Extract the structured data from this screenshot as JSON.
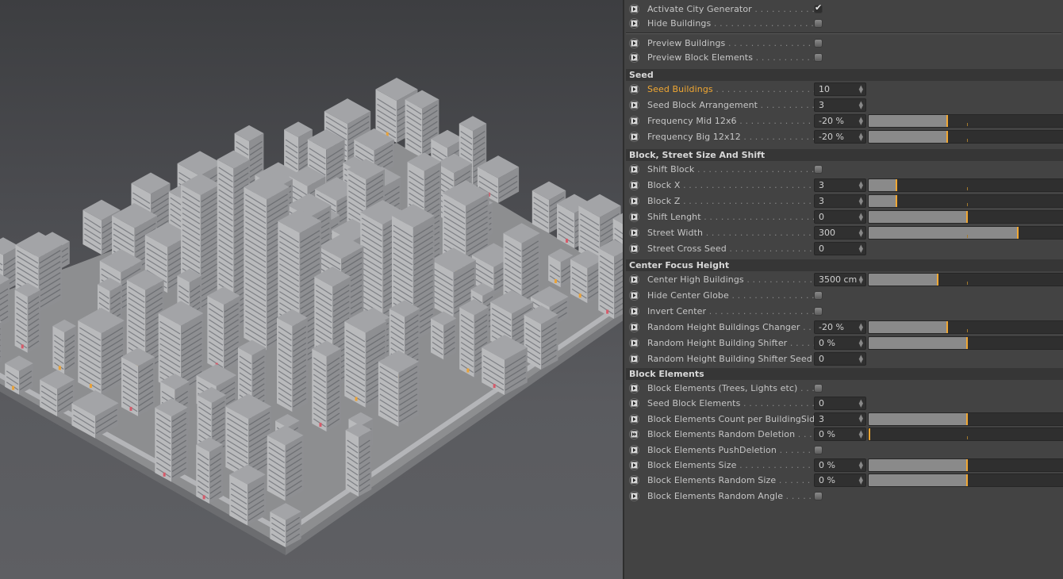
{
  "viewport": {
    "scene": "isometric-city-render",
    "background_color": "#4b4c50"
  },
  "panel": {
    "accent_color": "#f0a733",
    "top_rows": [
      {
        "label": "Activate City Generator",
        "type": "checkbox",
        "checked": true
      },
      {
        "label": "Hide Buildings",
        "type": "checkbox",
        "checked": false
      }
    ],
    "preview_rows": [
      {
        "label": "Preview Buildings",
        "type": "checkbox",
        "checked": false
      },
      {
        "label": "Preview Block Elements",
        "type": "checkbox",
        "checked": false
      }
    ],
    "groups": [
      {
        "title": "Seed",
        "rows": [
          {
            "label": "Seed Buildings",
            "type": "number",
            "value": "10",
            "active": true
          },
          {
            "label": "Seed Block Arrangement",
            "type": "number",
            "value": "3"
          },
          {
            "label": "Frequency Mid 12x6",
            "type": "slider",
            "value": "-20 %",
            "fraction": 0.4
          },
          {
            "label": "Frequency Big 12x12",
            "type": "slider",
            "value": "-20 %",
            "fraction": 0.4
          }
        ]
      },
      {
        "title": "Block, Street Size And Shift",
        "rows": [
          {
            "label": "Shift Block",
            "type": "checkbox",
            "checked": false
          },
          {
            "label": "Block X",
            "type": "slider",
            "value": "3",
            "fraction": 0.14
          },
          {
            "label": "Block Z",
            "type": "slider",
            "value": "3",
            "fraction": 0.14
          },
          {
            "label": "Shift Lenght",
            "type": "slider",
            "value": "0",
            "fraction": 0.5
          },
          {
            "label": "Street Width",
            "type": "slider",
            "value": "300",
            "fraction": 0.76
          },
          {
            "label": "Street Cross Seed",
            "type": "number",
            "value": "0"
          }
        ]
      },
      {
        "title": "Center Focus Height",
        "rows": [
          {
            "label": "Center High Buildings",
            "type": "slider",
            "value": "3500 cm",
            "fraction": 0.35
          },
          {
            "label": "Hide Center Globe",
            "type": "checkbox",
            "checked": false
          },
          {
            "label": "Invert Center",
            "type": "checkbox",
            "checked": false
          },
          {
            "label": "Random Height Buildings Changer",
            "type": "slider",
            "value": "-20 %",
            "fraction": 0.4
          },
          {
            "label": "Random Height Building Shifter",
            "type": "slider",
            "value": "0 %",
            "fraction": 0.5
          },
          {
            "label": "Random Height Building Shifter Seed",
            "type": "number",
            "value": "0"
          }
        ]
      },
      {
        "title": "Block Elements",
        "rows": [
          {
            "label": "Block Elements (Trees, Lights etc)",
            "type": "checkbox",
            "checked": false
          },
          {
            "label": "Seed Block Elements",
            "type": "number",
            "value": "0"
          },
          {
            "label": "Block Elements Count per BuildingSide",
            "type": "slider",
            "value": "3",
            "fraction": 0.5
          },
          {
            "label": "Block Elements Random Deletion",
            "type": "slider",
            "value": "0 %",
            "fraction": 0.0,
            "keyframed": true
          },
          {
            "label": "Block Elements PushDeletion",
            "type": "checkbox",
            "checked": false
          },
          {
            "label": "Block Elements Size",
            "type": "slider",
            "value": "0 %",
            "fraction": 0.5
          },
          {
            "label": "Block Elements Random Size",
            "type": "slider",
            "value": "0 %",
            "fraction": 0.5
          },
          {
            "label": "Block Elements Random Angle",
            "type": "checkbox",
            "checked": false
          }
        ]
      }
    ]
  }
}
